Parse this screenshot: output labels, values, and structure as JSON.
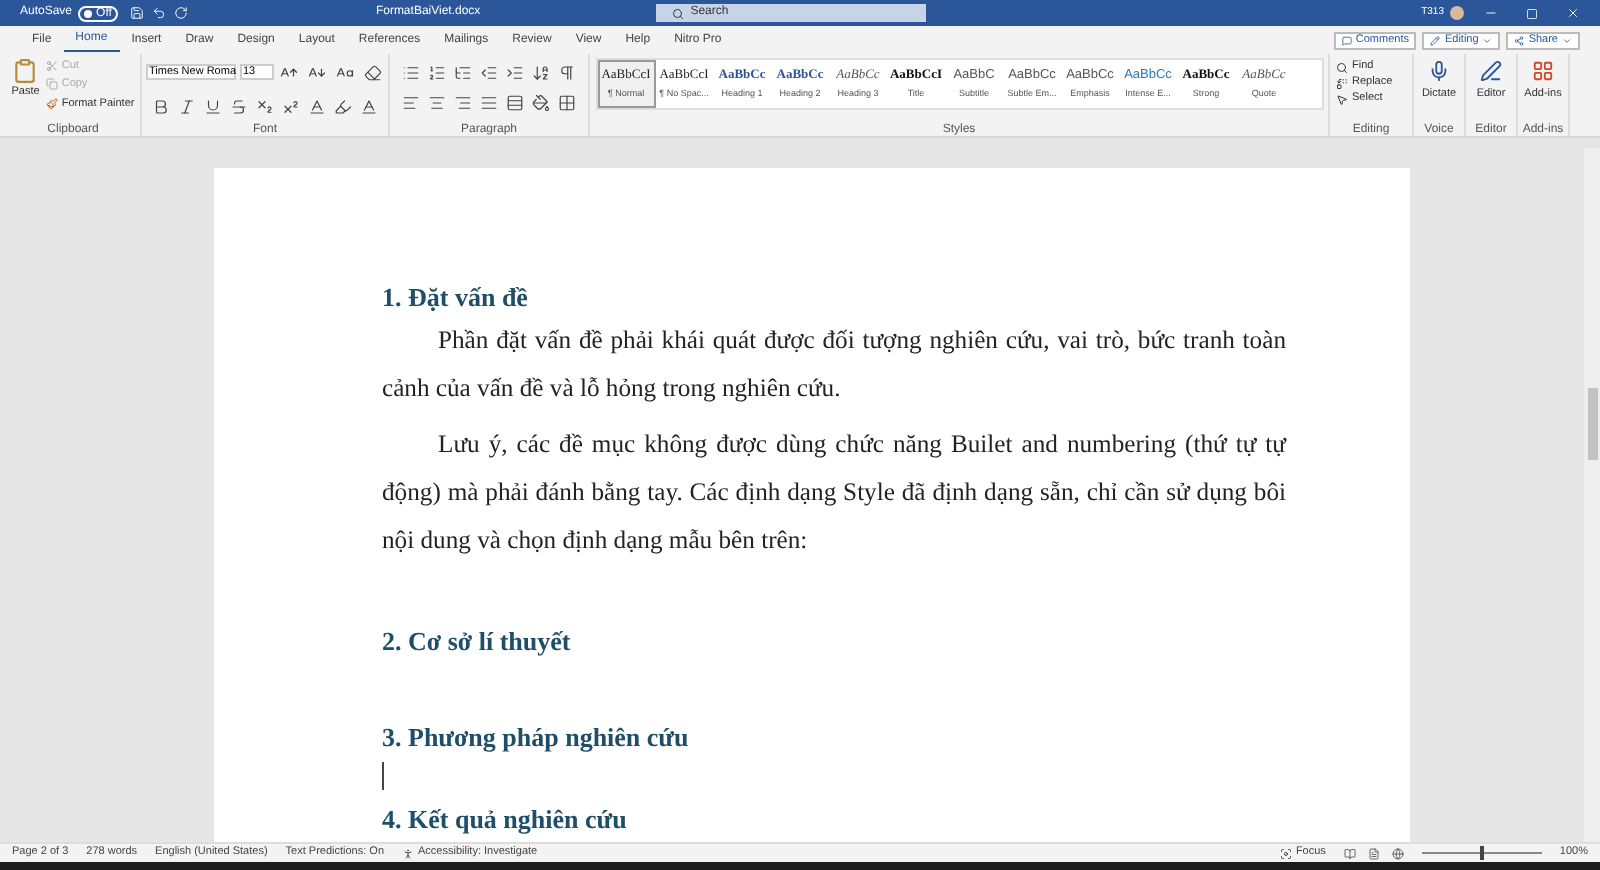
{
  "title_bar": {
    "autosave_label": "AutoSave",
    "autosave_state": "Off",
    "autosave_on": false,
    "filename": "FormatBaiViet.docx",
    "search_placeholder": "Search",
    "user": "T313"
  },
  "tabs": [
    {
      "label": "File",
      "selected": false
    },
    {
      "label": "Home",
      "selected": true
    },
    {
      "label": "Insert",
      "selected": false
    },
    {
      "label": "Draw",
      "selected": false
    },
    {
      "label": "Design",
      "selected": false
    },
    {
      "label": "Layout",
      "selected": false
    },
    {
      "label": "References",
      "selected": false
    },
    {
      "label": "Mailings",
      "selected": false
    },
    {
      "label": "Review",
      "selected": false
    },
    {
      "label": "View",
      "selected": false
    },
    {
      "label": "Help",
      "selected": false
    },
    {
      "label": "Nitro Pro",
      "selected": false
    }
  ],
  "header_buttons": [
    "Comments",
    "Editing",
    "Share"
  ],
  "ribbon": {
    "clipboard": {
      "paste": "Paste",
      "cut": {
        "label": "Cut",
        "disabled": true
      },
      "copy": {
        "label": "Copy",
        "disabled": true
      },
      "format_painter": "Format Painter",
      "label": "Clipboard"
    },
    "font": {
      "name": "Times New Roma",
      "size": "13",
      "label": "Font"
    },
    "paragraph": {
      "label": "Paragraph"
    },
    "styles": {
      "label": "Styles",
      "items": [
        {
          "preview": "AaBbCcI",
          "name": "¶ Normal",
          "kind": "body",
          "selected": true
        },
        {
          "preview": "AaBbCcI",
          "name": "¶ No Spac...",
          "kind": "body",
          "selected": false
        },
        {
          "preview": "AaBbCc",
          "name": "Heading 1",
          "kind": "heading",
          "selected": false
        },
        {
          "preview": "AaBbCc",
          "name": "Heading 2",
          "kind": "heading",
          "selected": false
        },
        {
          "preview": "AaBbCc",
          "name": "Heading 3",
          "kind": "subtle",
          "selected": false
        },
        {
          "preview": "AaBbCcI",
          "name": "Title",
          "kind": "strong",
          "selected": false
        },
        {
          "preview": "AaBbC",
          "name": "Subtitle",
          "kind": "light",
          "selected": false
        },
        {
          "preview": "AaBbCc",
          "name": "Subtle Em...",
          "kind": "light",
          "selected": false
        },
        {
          "preview": "AaBbCc",
          "name": "Emphasis",
          "kind": "light",
          "selected": false
        },
        {
          "preview": "AaBbCc",
          "name": "Intense E...",
          "kind": "accent",
          "selected": false
        },
        {
          "preview": "AaBbCc",
          "name": "Strong",
          "kind": "strong",
          "selected": false
        },
        {
          "preview": "AaBbCc",
          "name": "Quote",
          "kind": "subtle",
          "selected": false
        }
      ]
    },
    "editing": {
      "find": "Find",
      "replace": "Replace",
      "select": "Select",
      "label": "Editing"
    },
    "voice": {
      "button": "Dictate",
      "label": "Voice"
    },
    "editor": {
      "button": "Editor",
      "label": "Editor"
    },
    "addins": {
      "button": "Add-ins",
      "label": "Add-ins"
    }
  },
  "document": {
    "blocks": [
      {
        "kind": "heading",
        "text": "1. Đặt vấn đề"
      },
      {
        "kind": "paragraph",
        "text": "Phần đặt vấn đề phải khái quát được đối tượng nghiên cứu, vai trò, bức tranh toàn cảnh của vấn đề và lỗ hỏng trong nghiên cứu."
      },
      {
        "kind": "paragraph",
        "text": "Lưu ý, các đề mục không được dùng chức năng Builet and numbering (thứ tự tự động) mà phải đánh bằng tay. Các định dạng Style đã định dạng sẵn, chỉ cần sử dụng bôi nội dung và chọn định dạng mẫu bên trên:"
      },
      {
        "kind": "heading",
        "text": "2. Cơ sở lí thuyết"
      },
      {
        "kind": "heading",
        "text": "3. Phương pháp nghiên cứu"
      },
      {
        "kind": "cursor"
      },
      {
        "kind": "heading",
        "text": "4. Kết quả nghiên cứu"
      }
    ]
  },
  "status_bar": {
    "items": [
      "Page 2 of 3",
      "278 words",
      "English (United States)",
      "Text Predictions: On"
    ],
    "accessibility": "Accessibility: Investigate",
    "focus": "Focus",
    "zoom": "100%",
    "zoom_slider": {
      "level": 0.5
    }
  }
}
